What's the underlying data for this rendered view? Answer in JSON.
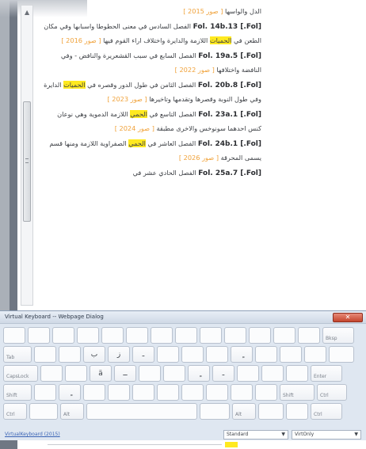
{
  "reader": {
    "entries": [
      {
        "pre": "",
        "ref": "",
        "text": "الدل والواسها ",
        "tag": "[ صور 2015 ]",
        "post": ""
      },
      {
        "pre": "",
        "ref": "[Fol.] Fol. 14b.13",
        "text": " الفصل السادس في معنى الحطوطا واسبابها وفي مكان الطعن في ",
        "hl": "الحميات",
        "text2": " اللازمة والدايرة واختلاف اراء القوم فيها ",
        "tag": "[ صور 2016 ]",
        "post": ""
      },
      {
        "ref": "[Fol.] Fol. 19a.5",
        "text": " الفصل السابع في سبب القشعريرة والنافض - وفي النافضة واختلافها ",
        "tag": "[ صور 2022 ]"
      },
      {
        "ref": "[Fol.] Fol. 20b.8",
        "text": " الفصل الثامن في طول الدور وقصره في ",
        "hl": "الحميات",
        "text2": " الدايرة وفي طول النوبة وقصرها وتقدمها وتاخيرها ",
        "tag": "[ صور 2023 ]"
      },
      {
        "ref": "[Fol.] Fol. 23a.1",
        "text": " الفصل التاسع في ",
        "hl": "الحمي",
        "text2": " اللازمة الدموية وهي نوعان كنس احدهما سونوخس والاخرى مطبقة ",
        "tag": "[ صور 2024 ]"
      },
      {
        "ref": "[Fol.] Fol. 24b.1",
        "text": " الفصل العاشر في ",
        "hl": "الحمي",
        "text2": " الصفراوية اللازمة ومنها قسم يسمى المحرقة ",
        "tag": "[ صور 2026 ]"
      },
      {
        "ref": "[Fol.] Fol. 25a.7",
        "text": " الفصل الحادي عشر في",
        "tag": ""
      }
    ]
  },
  "keyboard": {
    "title": "Virtual Keyboard -- Webpage Dialog",
    "close_label": "✕",
    "rows": [
      {
        "keys": [
          "",
          "",
          "",
          "",
          "",
          "",
          "",
          "",
          "",
          "",
          "",
          "",
          "",
          "Bksp"
        ]
      },
      {
        "keys": [
          "Tab",
          "",
          "",
          "ب",
          "ز",
          "ـ",
          "",
          "",
          "",
          "ٍ",
          "",
          "",
          "",
          ""
        ]
      },
      {
        "keys": [
          "CapsLock",
          "",
          "",
          "ä",
          "ــ",
          "",
          "",
          "ٍ",
          "ـ",
          "",
          "",
          "",
          "Enter"
        ]
      },
      {
        "keys": [
          "Shift",
          "",
          "ٍ",
          "",
          "",
          "",
          "",
          "",
          "",
          "",
          "",
          "Shift",
          "Ctrl"
        ]
      },
      {
        "keys": [
          "Ctrl",
          "",
          "Alt",
          "",
          "",
          "Alt",
          "",
          "",
          "Ctrl"
        ]
      }
    ],
    "link": "VirtualKeyboard (2015)",
    "layout_select": "Standard",
    "lang_select": "VirtOnly"
  }
}
